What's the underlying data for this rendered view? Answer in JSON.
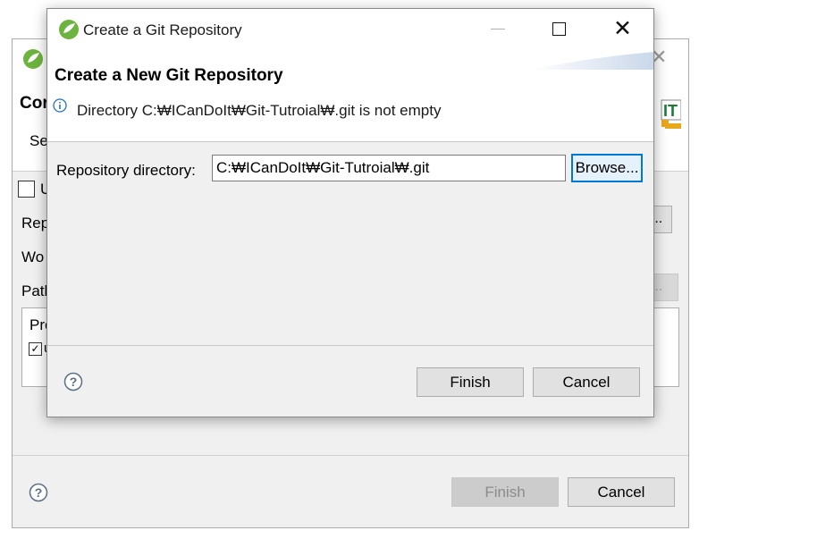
{
  "background_dialog": {
    "title_partial": "Cor",
    "subtitle_partial": "Se",
    "checkbox_label_partial": "U",
    "labels": [
      "Rep",
      "Wo",
      "Path"
    ],
    "browse_partial": "e...",
    "browse_disabled_partial": "e...",
    "projects_header_partial": "Pro",
    "project_item_checked": true,
    "project_item_partial": "u",
    "finish_label": "Finish",
    "cancel_label": "Cancel",
    "banner_text": "IT",
    "icons": {
      "logo": "spring-logo-icon",
      "close": "close-icon",
      "help": "help-icon"
    }
  },
  "dialog": {
    "title": "Create a Git Repository",
    "heading": "Create a New Git Repository",
    "message": "Directory C:₩ICanDoIt₩Git-Tutroial₩.git is not empty",
    "repo_dir_label": "Repository directory:",
    "repo_dir_value": "C:₩ICanDoIt₩Git-Tutroial₩.git",
    "browse_label": "Browse...",
    "finish_label": "Finish",
    "cancel_label": "Cancel",
    "icons": {
      "logo": "spring-logo-icon",
      "info": "info-icon",
      "help": "help-icon",
      "minimize": "minimize-icon",
      "maximize": "maximize-icon",
      "close": "close-icon"
    },
    "colors": {
      "accent": "#0078d7",
      "spring_green": "#6db33f"
    }
  }
}
